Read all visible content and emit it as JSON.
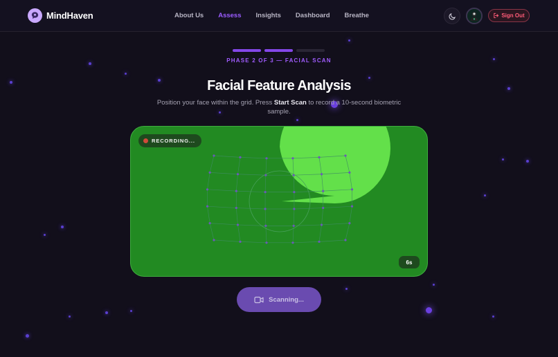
{
  "brand": {
    "name": "MindHaven",
    "logo_icon": "brain-chat-icon"
  },
  "nav": {
    "items": [
      {
        "label": "About Us",
        "active": false
      },
      {
        "label": "Assess",
        "active": true
      },
      {
        "label": "Insights",
        "active": false
      },
      {
        "label": "Dashboard",
        "active": false
      },
      {
        "label": "Breathe",
        "active": false
      }
    ]
  },
  "header_actions": {
    "theme_icon": "moon-icon",
    "avatar_icon": "avatar",
    "sign_out_label": "Sign Out",
    "sign_out_icon": "logout-icon"
  },
  "progress": {
    "total_phases": 3,
    "current_phase": 2,
    "label": "PHASE 2 OF 3 — FACIAL SCAN"
  },
  "page": {
    "title": "Facial Feature Analysis",
    "subtitle_before": "Position your face within the grid. Press ",
    "subtitle_bold": "Start Scan",
    "subtitle_after": " to record a 10-second biometric sample."
  },
  "camera": {
    "recording_label": "RECORDING...",
    "timer": "6s"
  },
  "scan_button": {
    "label": "Scanning...",
    "icon": "video-camera-icon"
  },
  "colors": {
    "accent": "#8447e8",
    "accent_text": "#a05cff",
    "camera_bg": "#228a22",
    "face": "#63e04a",
    "danger": "#ff5c78"
  }
}
